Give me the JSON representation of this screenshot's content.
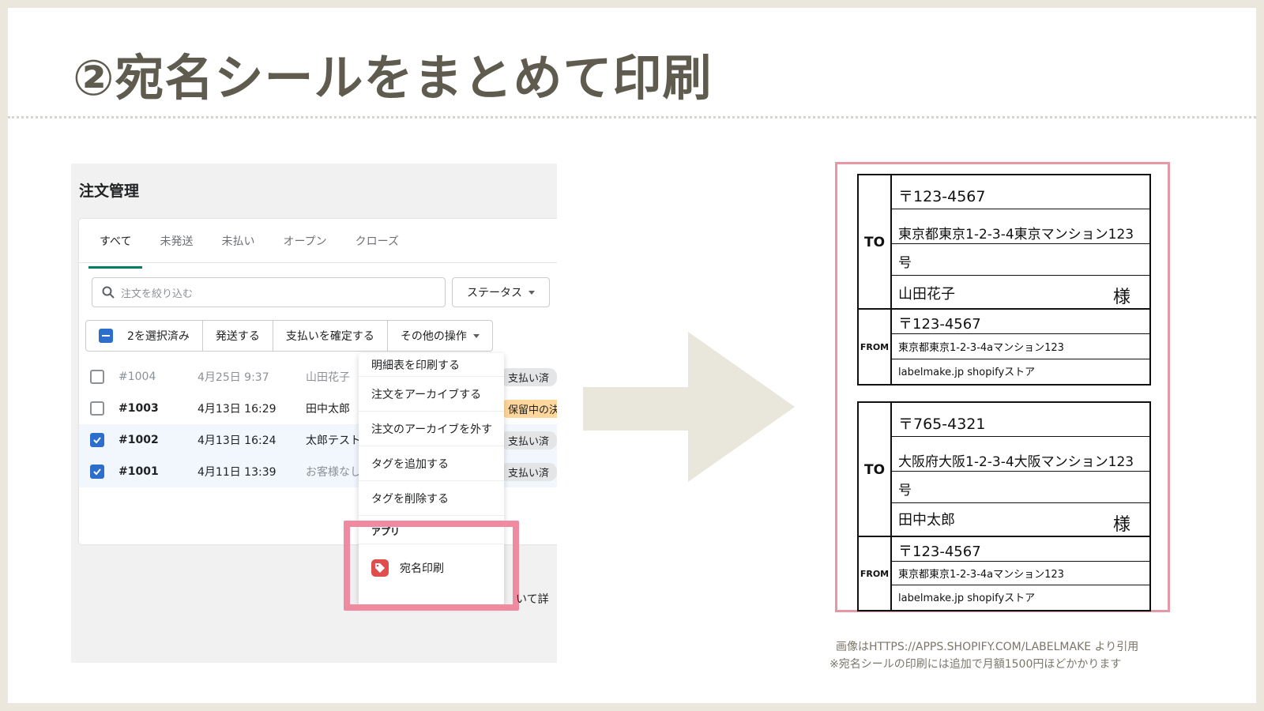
{
  "slide": {
    "title": "②宛名シールをまとめて印刷"
  },
  "app": {
    "title": "注文管理",
    "tabs": [
      "すべて",
      "未発送",
      "未払い",
      "オープン",
      "クローズ"
    ],
    "search_placeholder": "注文を絞り込む",
    "status_label": "ステータス",
    "bulk": {
      "selected_label": "2を選択済み",
      "ship_label": "発送する",
      "confirm_payment_label": "支払いを確定する",
      "more_label": "その他の操作"
    },
    "orders": [
      {
        "number": "#1004",
        "date": "4月25日 9:37",
        "customer": "山田花子",
        "status": "支払い済",
        "selected": false
      },
      {
        "number": "#1003",
        "date": "4月13日 16:29",
        "customer": "田中太郎",
        "status": "保留中の決",
        "selected": false
      },
      {
        "number": "#1002",
        "date": "4月13日 16:24",
        "customer": "太郎テスト",
        "status": "支払い済",
        "selected": true
      },
      {
        "number": "#1001",
        "date": "4月11日 13:39",
        "customer": "お客様なし",
        "status": "支払い済",
        "selected": true
      }
    ],
    "menu": {
      "items": [
        "明細表を印刷する",
        "注文をアーカイブする",
        "注文のアーカイブを外す",
        "タグを追加する",
        "タグを削除する"
      ],
      "section_label": "アプリ",
      "app_item_label": "宛名印刷"
    },
    "cut_text": "いて詳"
  },
  "labels": [
    {
      "to_tag": "TO",
      "to_postal": "〒123-4567",
      "to_address_1": "東京都東京1-2-3-4東京マンション123",
      "to_address_2": "号",
      "to_name": "山田花子",
      "honorific": "様",
      "from_tag": "FROM",
      "from_postal": "〒123-4567",
      "from_address": "東京都東京1-2-3-4aマンション123",
      "from_name": "labelmake.jp shopifyストア"
    },
    {
      "to_tag": "TO",
      "to_postal": "〒765-4321",
      "to_address_1": "大阪府大阪1-2-3-4大阪マンション123",
      "to_address_2": "号",
      "to_name": "田中太郎",
      "honorific": "様",
      "from_tag": "FROM",
      "from_postal": "〒123-4567",
      "from_address": "東京都東京1-2-3-4aマンション123",
      "from_name": "labelmake.jp shopifyストア"
    }
  ],
  "footnote": {
    "line1": "画像はHTTPS://APPS.SHOPIFY.COM/LABELMAKE より引用",
    "line2": "※宛名シールの印刷には追加で月額1500円ほどかかります"
  },
  "colors": {
    "background": "#ebe7dc",
    "title": "#5f5b4e",
    "highlight": "#ef8aa0",
    "arrow": "#e9e6dc",
    "checkbox": "#2c6ecb",
    "tab_active": "#008060"
  }
}
